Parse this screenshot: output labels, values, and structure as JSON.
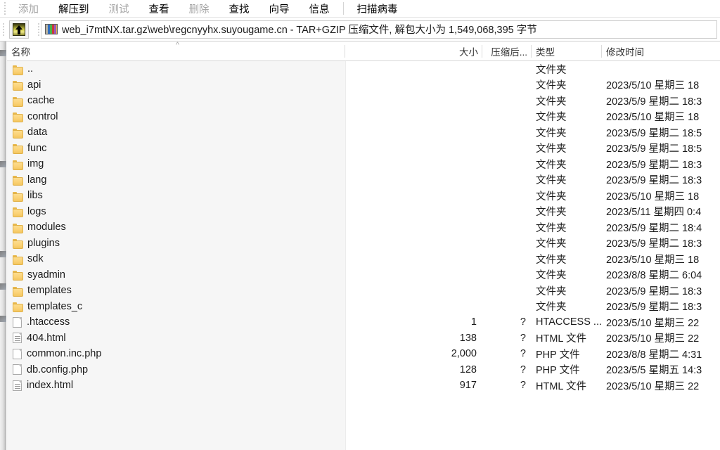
{
  "toolbar": {
    "buttons": [
      {
        "label": "添加",
        "enabled": false
      },
      {
        "label": "解压到",
        "enabled": true
      },
      {
        "label": "测试",
        "enabled": false
      },
      {
        "label": "查看",
        "enabled": true
      },
      {
        "label": "删除",
        "enabled": false
      },
      {
        "label": "查找",
        "enabled": true
      },
      {
        "label": "向导",
        "enabled": true
      },
      {
        "label": "信息",
        "enabled": true
      },
      {
        "label": "扫描病毒",
        "enabled": true
      }
    ],
    "separator_before_index": 8
  },
  "addressbar": {
    "up_button_label": "向上一级",
    "archive_icon": "winrar-archive-icon",
    "path_text": "web_i7mtNX.tar.gz\\web\\regcnyyhx.suyougame.cn - TAR+GZIP 压缩文件, 解包大小为 1,549,068,395 字节"
  },
  "columns": {
    "name": "名称",
    "size": "大小",
    "packed": "压缩后...",
    "type": "类型",
    "modified": "修改时间",
    "sort_caret": "^"
  },
  "files": [
    {
      "name": "..",
      "icon": "folder",
      "size": "",
      "packed": "",
      "type": "文件夹",
      "modified": ""
    },
    {
      "name": "api",
      "icon": "folder",
      "size": "",
      "packed": "",
      "type": "文件夹",
      "modified": "2023/5/10 星期三 18"
    },
    {
      "name": "cache",
      "icon": "folder",
      "size": "",
      "packed": "",
      "type": "文件夹",
      "modified": "2023/5/9 星期二 18:3"
    },
    {
      "name": "control",
      "icon": "folder",
      "size": "",
      "packed": "",
      "type": "文件夹",
      "modified": "2023/5/10 星期三 18"
    },
    {
      "name": "data",
      "icon": "folder",
      "size": "",
      "packed": "",
      "type": "文件夹",
      "modified": "2023/5/9 星期二 18:5"
    },
    {
      "name": "func",
      "icon": "folder",
      "size": "",
      "packed": "",
      "type": "文件夹",
      "modified": "2023/5/9 星期二 18:5"
    },
    {
      "name": "img",
      "icon": "folder",
      "size": "",
      "packed": "",
      "type": "文件夹",
      "modified": "2023/5/9 星期二 18:3"
    },
    {
      "name": "lang",
      "icon": "folder",
      "size": "",
      "packed": "",
      "type": "文件夹",
      "modified": "2023/5/9 星期二 18:3"
    },
    {
      "name": "libs",
      "icon": "folder",
      "size": "",
      "packed": "",
      "type": "文件夹",
      "modified": "2023/5/10 星期三 18"
    },
    {
      "name": "logs",
      "icon": "folder",
      "size": "",
      "packed": "",
      "type": "文件夹",
      "modified": "2023/5/11 星期四 0:4"
    },
    {
      "name": "modules",
      "icon": "folder",
      "size": "",
      "packed": "",
      "type": "文件夹",
      "modified": "2023/5/9 星期二 18:4"
    },
    {
      "name": "plugins",
      "icon": "folder",
      "size": "",
      "packed": "",
      "type": "文件夹",
      "modified": "2023/5/9 星期二 18:3"
    },
    {
      "name": "sdk",
      "icon": "folder",
      "size": "",
      "packed": "",
      "type": "文件夹",
      "modified": "2023/5/10 星期三 18"
    },
    {
      "name": "syadmin",
      "icon": "folder",
      "size": "",
      "packed": "",
      "type": "文件夹",
      "modified": "2023/8/8 星期二 6:04"
    },
    {
      "name": "templates",
      "icon": "folder",
      "size": "",
      "packed": "",
      "type": "文件夹",
      "modified": "2023/5/9 星期二 18:3"
    },
    {
      "name": "templates_c",
      "icon": "folder",
      "size": "",
      "packed": "",
      "type": "文件夹",
      "modified": "2023/5/9 星期二 18:3"
    },
    {
      "name": ".htaccess",
      "icon": "doc",
      "size": "1",
      "packed": "?",
      "type": "HTACCESS ...",
      "modified": "2023/5/10 星期三 22"
    },
    {
      "name": "404.html",
      "icon": "doc-lines",
      "size": "138",
      "packed": "?",
      "type": "HTML 文件",
      "modified": "2023/5/10 星期三 22"
    },
    {
      "name": "common.inc.php",
      "icon": "doc",
      "size": "2,000",
      "packed": "?",
      "type": "PHP 文件",
      "modified": "2023/8/8 星期二 4:31"
    },
    {
      "name": "db.config.php",
      "icon": "doc",
      "size": "128",
      "packed": "?",
      "type": "PHP 文件",
      "modified": "2023/5/5 星期五 14:3"
    },
    {
      "name": "index.html",
      "icon": "doc-lines",
      "size": "917",
      "packed": "?",
      "type": "HTML 文件",
      "modified": "2023/5/10 星期三 22"
    }
  ],
  "theme": {
    "folder_color": "#fbd277",
    "name_column_bg": "#f6f6f6",
    "disabled_text": "#a6a6a6",
    "text": "#1b1b1b"
  }
}
